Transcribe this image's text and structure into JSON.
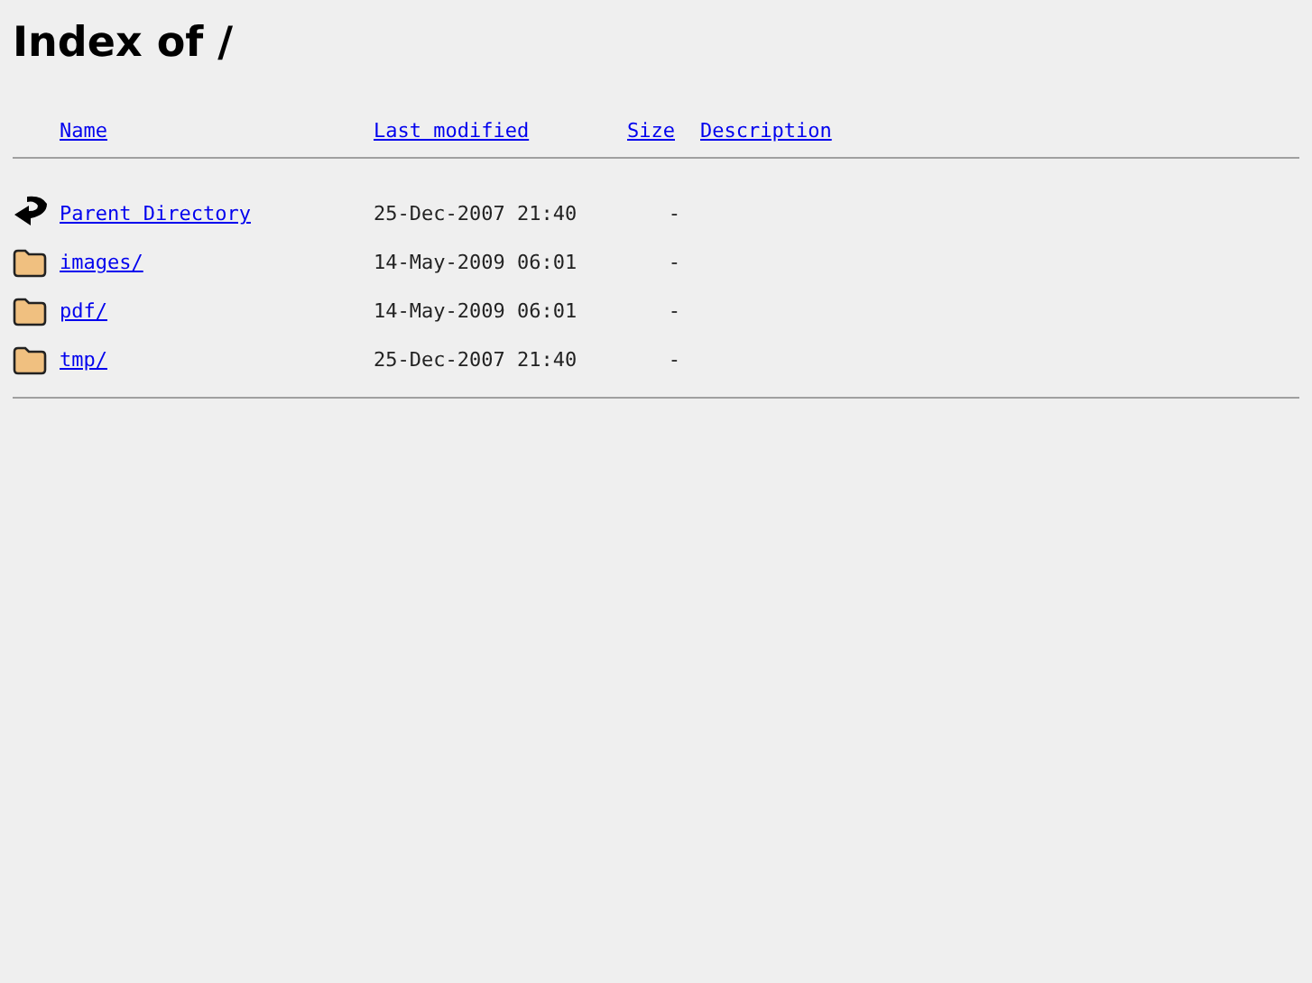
{
  "title": "Index of /",
  "columns": [
    "Name",
    "Last modified",
    "Size",
    "Description"
  ],
  "rows": [
    {
      "kind": "parent",
      "name": "Parent Directory",
      "modified": "25-Dec-2007 21:40",
      "size": "-"
    },
    {
      "kind": "folder",
      "name": "images/",
      "modified": "14-May-2009 06:01",
      "size": "-"
    },
    {
      "kind": "folder",
      "name": "pdf/",
      "modified": "14-May-2009 06:01",
      "size": "-"
    },
    {
      "kind": "folder",
      "name": "tmp/",
      "modified": "25-Dec-2007 21:40",
      "size": "-"
    }
  ]
}
